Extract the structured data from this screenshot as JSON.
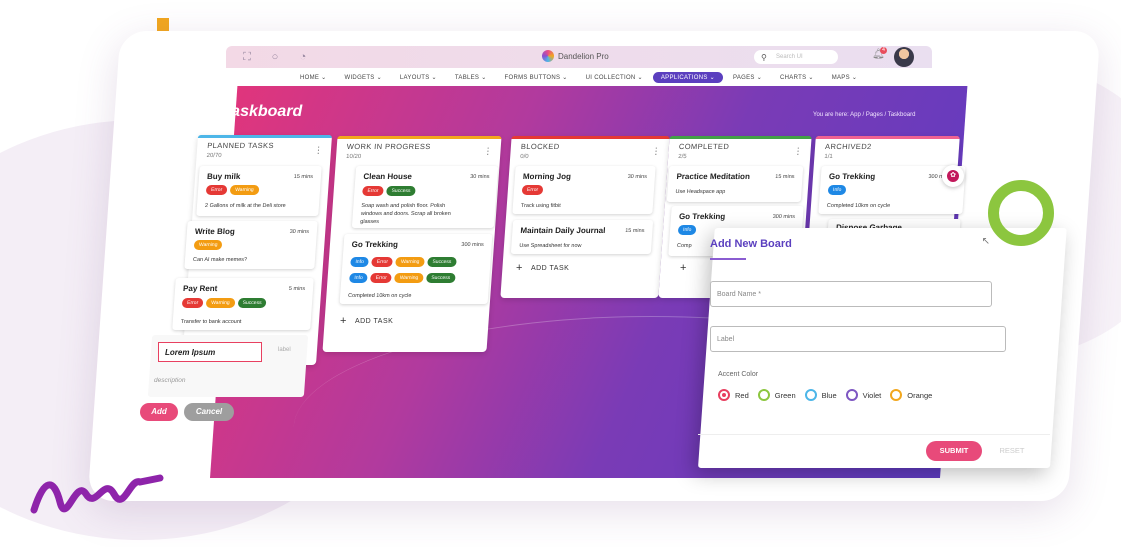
{
  "app": {
    "brand": "Dandelion Pro",
    "search_placeholder": "Search UI",
    "notification_count": "4"
  },
  "menu": [
    {
      "label": "HOME"
    },
    {
      "label": "WIDGETS"
    },
    {
      "label": "LAYOUTS"
    },
    {
      "label": "TABLES"
    },
    {
      "label": "FORMS BUTTONS"
    },
    {
      "label": "UI COLLECTION"
    },
    {
      "label": "APPLICATIONS"
    },
    {
      "label": "PAGES"
    },
    {
      "label": "CHARTS"
    },
    {
      "label": "MAPS"
    }
  ],
  "page": {
    "title": "Taskboard",
    "breadcrumb": "You are here:  App  /  Pages  /  Taskboard"
  },
  "columns": {
    "planned": {
      "header": "PLANNED TASKS",
      "count": "20/70",
      "accent": "#4db6e8",
      "cards": [
        {
          "title": "Buy milk",
          "time": "15 mins",
          "tags": [
            "Error",
            "Warning"
          ],
          "desc": "2 Gallons of milk at the Deli store"
        },
        {
          "title": "Write Blog",
          "time": "30 mins",
          "tags": [
            "Warning"
          ],
          "desc": "Can AI make memes?"
        },
        {
          "title": "Pay Rent",
          "time": "5 mins",
          "tags": [
            "Error",
            "Warning",
            "Success"
          ],
          "desc": "Transfer to bank account"
        }
      ],
      "new_task": {
        "title_value": "Lorem Ipsum",
        "label_placeholder": "label",
        "description_placeholder": "description",
        "add": "Add",
        "cancel": "Cancel"
      }
    },
    "progress": {
      "header": "WORK IN PROGRESS",
      "count": "10/20",
      "accent": "#f2a71e",
      "cards": [
        {
          "title": "Clean House",
          "time": "30 mins",
          "tags": [
            "Error",
            "Success"
          ],
          "desc_line1": "Soap wash and polish floor. Polish",
          "desc_line2": "windows and doors. Scrap all broken",
          "desc_line3": "glasses"
        },
        {
          "title": "Go Trekking",
          "time": "300 mins",
          "tags_row1": [
            "Info",
            "Error",
            "Warning",
            "Success"
          ],
          "tags_row2": [
            "Info",
            "Error",
            "Warning",
            "Success"
          ],
          "desc": "Completed 10km on cycle"
        }
      ],
      "add_task": "ADD TASK"
    },
    "blocked": {
      "header": "BLOCKED",
      "count": "0/0",
      "accent": "#e53935",
      "cards": [
        {
          "title": "Morning Jog",
          "time": "30 mins",
          "tags": [
            "Error"
          ],
          "desc": "Track using fitbit"
        },
        {
          "title": "Maintain Daily Journal",
          "time": "15 mins",
          "desc": "Use Spreadsheet for now"
        }
      ],
      "add_task": "ADD TASK"
    },
    "completed": {
      "header": "COMPLETED",
      "count": "2/5",
      "accent": "#43a047",
      "cards": [
        {
          "title": "Practice Meditation",
          "time": "15 mins",
          "desc": "Use Headspace app"
        },
        {
          "title": "Go Trekking",
          "time": "300 mins",
          "tags": [
            "Info"
          ],
          "desc": "Comp"
        }
      ],
      "add_task_symbol": "+"
    },
    "archived": {
      "header": "ARCHIVED2",
      "count": "1/1",
      "accent": "#f06292",
      "cards": [
        {
          "title": "Go Trekking",
          "time": "300 mi",
          "tags": [
            "Info"
          ],
          "desc": "Completed 10km on cycle"
        },
        {
          "title": "Dispose Garbage"
        }
      ]
    }
  },
  "dialog": {
    "title": "Add New Board",
    "board_name_placeholder": "Board Name *",
    "label_placeholder": "Label",
    "accent_label": "Accent Color",
    "colors": [
      {
        "label": "Red",
        "hex": "#e84060",
        "selected": true
      },
      {
        "label": "Green",
        "hex": "#8cc63f"
      },
      {
        "label": "Blue",
        "hex": "#4db6e8"
      },
      {
        "label": "Violet",
        "hex": "#7e57c2"
      },
      {
        "label": "Orange",
        "hex": "#f2a71e"
      }
    ],
    "submit": "SUBMIT",
    "reset": "RESET"
  }
}
